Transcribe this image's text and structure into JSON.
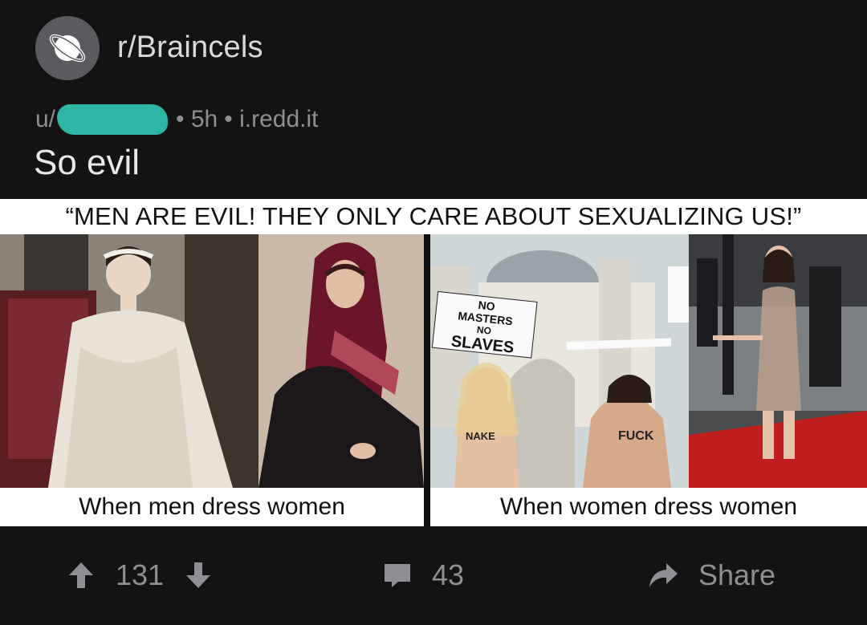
{
  "post": {
    "subreddit": "r/Braincels",
    "author_prefix": "u/",
    "age": "• 5h",
    "domain": "• i.redd.it",
    "title": "So evil"
  },
  "image": {
    "top_caption": "“MEN ARE EVIL! THEY ONLY CARE ABOUT SEXUALIZING US!”",
    "left_label": "When men dress women",
    "right_label": "When women dress women",
    "sign_text": [
      "NO",
      "MASTERS",
      "NO",
      "SLAVES"
    ],
    "body_text_1": "NAKE",
    "body_text_2": "FUCK"
  },
  "actions": {
    "upvotes": "131",
    "comments": "43",
    "share_label": "Share"
  },
  "colors": {
    "background": "#131314",
    "icon_bg": "#5a5b5e",
    "redaction": "#2eb5a5",
    "muted_text": "#8d8f92"
  },
  "icons": [
    "subreddit-planet-icon",
    "upvote-icon",
    "downvote-icon",
    "comment-icon",
    "share-icon"
  ]
}
